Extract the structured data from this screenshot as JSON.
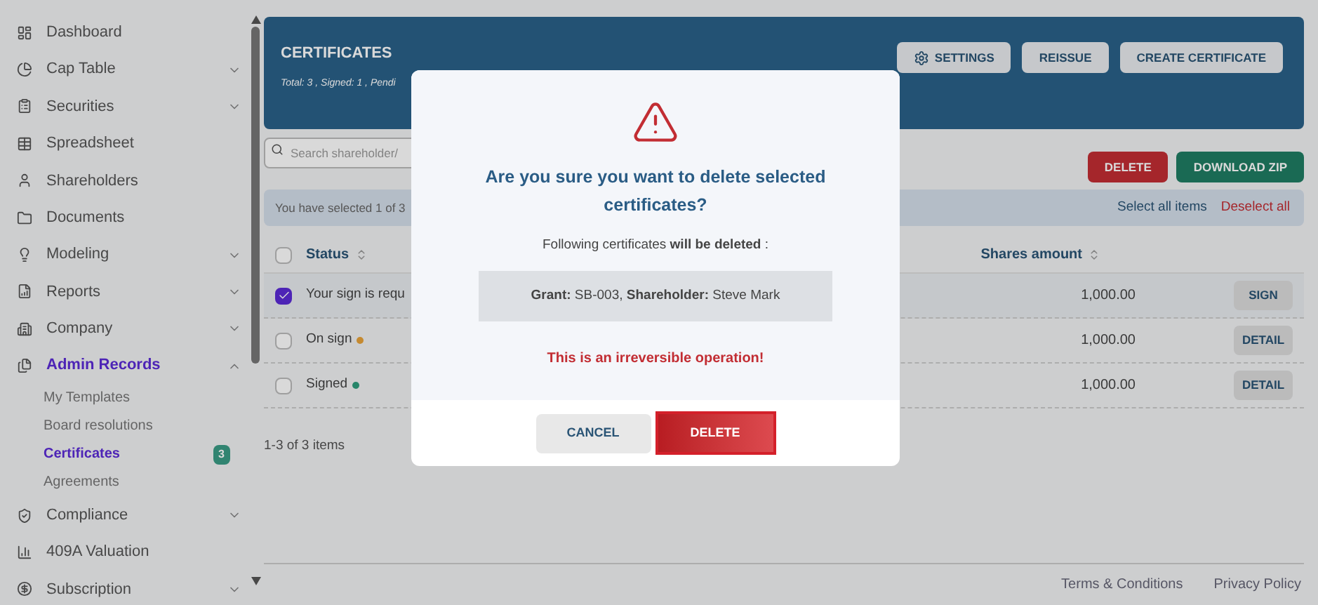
{
  "sidebar": {
    "items": [
      {
        "label": "Dashboard",
        "expandable": false,
        "selected": false
      },
      {
        "label": "Cap Table",
        "expandable": true,
        "expanded": false,
        "selected": false
      },
      {
        "label": "Securities",
        "expandable": true,
        "expanded": false,
        "selected": false
      },
      {
        "label": "Spreadsheet",
        "expandable": false,
        "selected": false
      },
      {
        "label": "Shareholders",
        "expandable": false,
        "selected": false
      },
      {
        "label": "Documents",
        "expandable": false,
        "selected": false
      },
      {
        "label": "Modeling",
        "expandable": true,
        "expanded": false,
        "selected": false
      },
      {
        "label": "Reports",
        "expandable": true,
        "expanded": false,
        "selected": false
      },
      {
        "label": "Company",
        "expandable": true,
        "expanded": false,
        "selected": false
      },
      {
        "label": "Admin Records",
        "expandable": true,
        "expanded": true,
        "selected": true,
        "children": [
          {
            "label": "My Templates",
            "selected": false
          },
          {
            "label": "Board resolutions",
            "selected": false
          },
          {
            "label": "Certificates",
            "selected": true,
            "badge": "3"
          },
          {
            "label": "Agreements",
            "selected": false
          }
        ]
      },
      {
        "label": "Compliance",
        "expandable": true,
        "expanded": false,
        "selected": false
      },
      {
        "label": "409A Valuation",
        "expandable": false,
        "selected": false
      },
      {
        "label": "Subscription",
        "expandable": true,
        "expanded": false,
        "selected": false
      }
    ]
  },
  "header": {
    "title": "CERTIFICATES",
    "summary": "Total: 3 , Signed: 1 , Pendi",
    "buttons": [
      "SETTINGS",
      "REISSUE",
      "CREATE CERTIFICATE"
    ]
  },
  "search": {
    "placeholder": "Search shareholder/"
  },
  "actions": {
    "delete": "DELETE",
    "download": "DOWNLOAD ZIP"
  },
  "selection_bar": {
    "text": "You have selected 1 of 3",
    "select_all": "Select all items",
    "deselect_all": "Deselect all"
  },
  "table": {
    "columns": [
      "Status",
      "Shares amount"
    ],
    "all_checked": false,
    "rows": [
      {
        "checked": true,
        "status": "Your sign is requ",
        "color": null,
        "amount": "1,000.00",
        "action": "SIGN"
      },
      {
        "checked": false,
        "status": "On sign",
        "color": "#c58a31",
        "amount": "1,000.00",
        "action": "DETAIL"
      },
      {
        "checked": false,
        "status": "Signed",
        "color": "#27866a",
        "amount": "1,000.00",
        "action": "DETAIL"
      }
    ]
  },
  "pagination": "1-3 of 3 items",
  "footer": {
    "links": [
      "Terms & Conditions",
      "Privacy Policy"
    ]
  },
  "modal": {
    "title": "Are you sure you want to delete selected certificates?",
    "message": "Following certificates **will be deleted** :",
    "item": "**Grant:** SB-003, **Shareholder:** Steve Mark",
    "warning": "This is an irreversible operation!",
    "cancel": "CANCEL",
    "confirm": "DELETE"
  }
}
